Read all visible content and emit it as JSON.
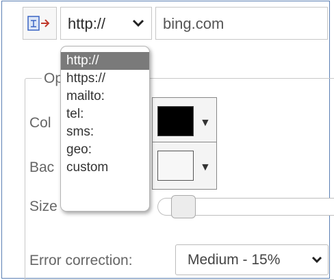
{
  "toolbar": {
    "icon": "link-arrow-icon",
    "protocol_value": "http://",
    "url_value": "bing.com"
  },
  "options": {
    "legend": "Op",
    "color_label": "Col",
    "background_label": "Bac",
    "size_label": "Size",
    "error_label": "Error correction:",
    "error_value": "Medium - 15%",
    "colors": {
      "foreground": "#000000",
      "background": "#f7f7f7"
    }
  },
  "dropdown": {
    "items": [
      "http://",
      "https://",
      "mailto:",
      "tel:",
      "sms:",
      "geo:",
      "custom"
    ],
    "selected_index": 0
  }
}
